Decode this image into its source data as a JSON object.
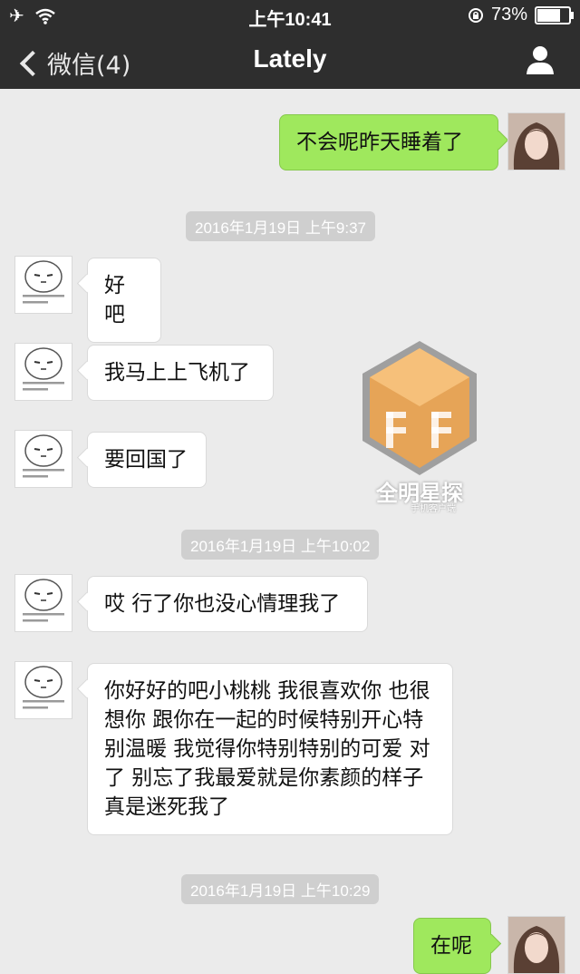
{
  "status_bar": {
    "time": "上午10:41",
    "battery": "73%",
    "battery_level": 0.73
  },
  "nav": {
    "back_label": "微信(4)",
    "title": "Lately"
  },
  "messages": [
    {
      "dir": "out",
      "text": "不会呢昨天睡着了"
    },
    {
      "dir": "time",
      "text": "2016年1月19日 上午9:37"
    },
    {
      "dir": "in",
      "text": "好吧"
    },
    {
      "dir": "in",
      "text": "我马上上飞机了"
    },
    {
      "dir": "in",
      "text": "要回国了"
    },
    {
      "dir": "time",
      "text": "2016年1月19日 上午10:02"
    },
    {
      "dir": "in",
      "text": "哎 行了你也没心情理我了"
    },
    {
      "dir": "in",
      "text": "你好好的吧小桃桃 我很喜欢你 也很想你 跟你在一起的时候特别开心特别温暖 我觉得你特别特别的可爱 对了 别忘了我最爱就是你素颜的样子 真是迷死我了"
    },
    {
      "dir": "time",
      "text": "2016年1月19日 上午10:29"
    },
    {
      "dir": "out",
      "text": "在呢"
    }
  ],
  "watermark": {
    "title": "全明星探",
    "subtitle": "手机客户端"
  }
}
